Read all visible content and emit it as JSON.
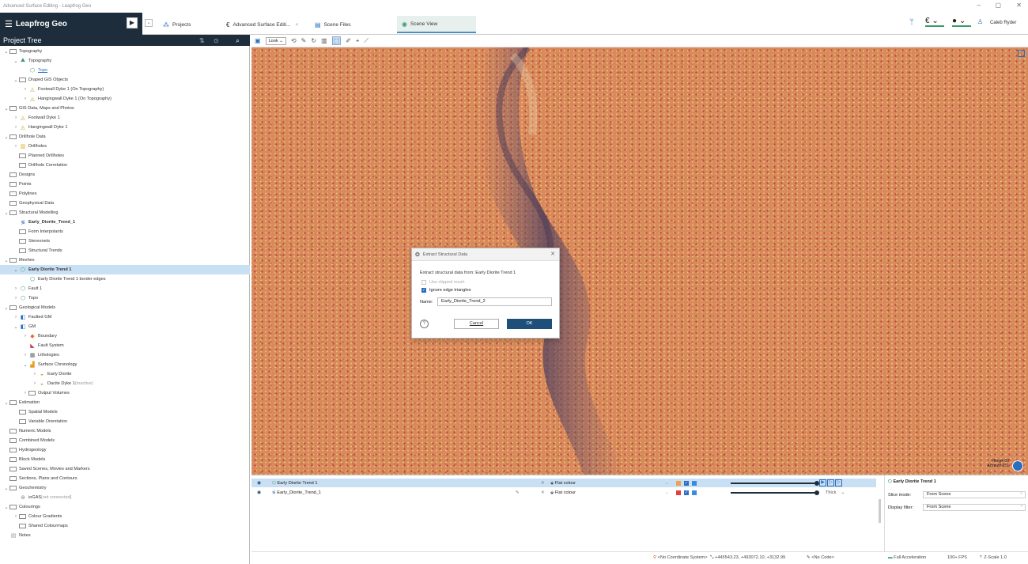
{
  "window": {
    "title": "Advanced Surface Editing - Leapfrog Geo",
    "controls": [
      "–",
      "▢",
      "✕"
    ]
  },
  "app": {
    "brand": "Leapfrog Geo",
    "tabs": [
      {
        "label": "Projects"
      },
      {
        "label": "Advanced Surface Editi...",
        "close": "×"
      },
      {
        "label": "Scene Files"
      },
      {
        "label": "Scene View"
      }
    ],
    "user": "Caleb Ryder"
  },
  "project_tree": {
    "title": "Project Tree",
    "items": [
      {
        "label": "Topography",
        "depth": 0,
        "arrow": "v",
        "icon": "folder"
      },
      {
        "label": "Topography",
        "depth": 1,
        "arrow": "v",
        "icon": "topo-icon"
      },
      {
        "label": "Topo",
        "depth": 2,
        "icon": "mesh-icon",
        "link": true
      },
      {
        "label": "Draped GIS Objects",
        "depth": 1,
        "arrow": "v",
        "icon": "folder"
      },
      {
        "label": "Footwall Dyke 1 (On Topography)",
        "depth": 2,
        "arrow": ">",
        "icon": "gis-icon"
      },
      {
        "label": "Hangingwall Dyke 1 (On Topography)",
        "depth": 2,
        "arrow": ">",
        "icon": "gis-icon"
      },
      {
        "label": "GIS Data, Maps and Photos",
        "depth": 0,
        "arrow": "v",
        "icon": "folder"
      },
      {
        "label": "Footwall Dyke 1",
        "depth": 1,
        "arrow": ">",
        "icon": "gis-icon"
      },
      {
        "label": "Hangingwall Dyke 1",
        "depth": 1,
        "arrow": ">",
        "icon": "gis-icon"
      },
      {
        "label": "Drillhole Data",
        "depth": 0,
        "arrow": "v",
        "icon": "folder"
      },
      {
        "label": "Drillholes",
        "depth": 1,
        "arrow": ">",
        "icon": "drillholes-icon"
      },
      {
        "label": "Planned Drillholes",
        "depth": 1,
        "icon": "folder"
      },
      {
        "label": "Drillhole Correlation",
        "depth": 1,
        "icon": "folder"
      },
      {
        "label": "Designs",
        "depth": 0,
        "icon": "folder"
      },
      {
        "label": "Points",
        "depth": 0,
        "icon": "folder"
      },
      {
        "label": "Polylines",
        "depth": 0,
        "icon": "folder"
      },
      {
        "label": "Geophysical Data",
        "depth": 0,
        "icon": "folder"
      },
      {
        "label": "Structural Modelling",
        "depth": 0,
        "arrow": "v",
        "icon": "folder"
      },
      {
        "label": "Early_Diorite_Trend_1",
        "depth": 1,
        "icon": "structural-icon",
        "bold": true
      },
      {
        "label": "Form Interpolants",
        "depth": 1,
        "icon": "folder"
      },
      {
        "label": "Stereonets",
        "depth": 1,
        "icon": "folder"
      },
      {
        "label": "Structural Trends",
        "depth": 1,
        "icon": "folder"
      },
      {
        "label": "Meshes",
        "depth": 0,
        "arrow": "v",
        "icon": "folder"
      },
      {
        "label": "Early Diorite Trend 1",
        "depth": 1,
        "arrow": "v",
        "icon": "mesh-icon",
        "bold": true,
        "selected": true
      },
      {
        "label": "Early Diorite Trend 1 border edges",
        "depth": 2,
        "icon": "edges-icon"
      },
      {
        "label": "Fault 1",
        "depth": 1,
        "arrow": ">",
        "icon": "mesh-icon"
      },
      {
        "label": "Topo",
        "depth": 1,
        "arrow": ">",
        "icon": "mesh-icon"
      },
      {
        "label": "Geological Models",
        "depth": 0,
        "arrow": "v",
        "icon": "folder"
      },
      {
        "label": "Faulted GM",
        "depth": 1,
        "arrow": ">",
        "icon": "gm-icon"
      },
      {
        "label": "GM",
        "depth": 1,
        "arrow": "v",
        "icon": "gm-icon"
      },
      {
        "label": "Boundary",
        "depth": 2,
        "arrow": ">",
        "icon": "boundary-icon"
      },
      {
        "label": "Fault System",
        "depth": 2,
        "icon": "fault-icon"
      },
      {
        "label": "Lithologies",
        "depth": 2,
        "arrow": ">",
        "icon": "table-icon"
      },
      {
        "label": "Surface Chronology",
        "depth": 2,
        "arrow": "v",
        "icon": "chronology-icon"
      },
      {
        "label": "Early Diorite",
        "depth": 3,
        "arrow": ">",
        "icon": "surface-icon"
      },
      {
        "label": "Dacite Dyke 1",
        "suffix": " (Inactive)",
        "depth": 3,
        "arrow": ">",
        "icon": "surface-icon"
      },
      {
        "label": "Output Volumes",
        "depth": 2,
        "arrow": ">",
        "icon": "folder"
      },
      {
        "label": "Estimation",
        "depth": 0,
        "arrow": "v",
        "icon": "folder"
      },
      {
        "label": "Spatial Models",
        "depth": 1,
        "icon": "folder"
      },
      {
        "label": "Variable Orientation",
        "depth": 1,
        "icon": "folder"
      },
      {
        "label": "Numeric Models",
        "depth": 0,
        "icon": "folder"
      },
      {
        "label": "Combined Models",
        "depth": 0,
        "icon": "folder"
      },
      {
        "label": "Hydrogeology",
        "depth": 0,
        "icon": "folder"
      },
      {
        "label": "Block Models",
        "depth": 0,
        "icon": "folder"
      },
      {
        "label": "Saved Scenes, Movies and Markers",
        "depth": 0,
        "icon": "folder"
      },
      {
        "label": "Sections, Plans and Contours",
        "depth": 0,
        "icon": "folder"
      },
      {
        "label": "Geochemistry",
        "depth": 0,
        "arrow": "v",
        "icon": "folder"
      },
      {
        "label": "ioGAS",
        "suffix": " [not connected]",
        "depth": 1,
        "icon": "iogas-icon"
      },
      {
        "label": "Colourings",
        "depth": 0,
        "arrow": "v",
        "icon": "folder"
      },
      {
        "label": "Colour Gradients",
        "depth": 1,
        "arrow": ">",
        "icon": "folder"
      },
      {
        "label": "Shared Colourmaps",
        "depth": 1,
        "icon": "folder"
      },
      {
        "label": "Notes",
        "depth": 0,
        "icon": "notes-icon"
      }
    ]
  },
  "toolbar": {
    "look": "Look"
  },
  "viewport": {
    "plunge": "Plunge 00",
    "azimuth": "Azimuth 251"
  },
  "dialog": {
    "title": "Extract Structural Data",
    "message": "Extract structural data from: Early Diorite Trend 1",
    "use_clipped": "Use clipped mesh",
    "ignore_edges": "Ignore edge triangles",
    "name_label": "Name:",
    "name_value": "Early_Diorite_Trend_2",
    "cancel": "Cancel",
    "ok": "OK"
  },
  "shape_list": [
    {
      "name": "Early Diorite Trend 1",
      "colouring": "Flat colour",
      "swatch": "#f0a050",
      "selected": true
    },
    {
      "name": "Early_Diorite_Trend_1",
      "colouring": "Flat colour",
      "swatch": "#e04040",
      "style": "Thick"
    }
  ],
  "properties": {
    "title": "Early Diorite Trend 1",
    "slice_mode_label": "Slice mode:",
    "slice_mode_value": "From Scene",
    "display_filter_label": "Display filter:",
    "display_filter_value": "From Scene"
  },
  "status": {
    "coord_system": "<No Coordinate System>",
    "coords": "+445543.23, +493072.10, +3132.99",
    "code": "<No Code>",
    "acceleration": "Full Acceleration",
    "fps": "100+ FPS",
    "zscale": "Z-Scale 1.0"
  }
}
